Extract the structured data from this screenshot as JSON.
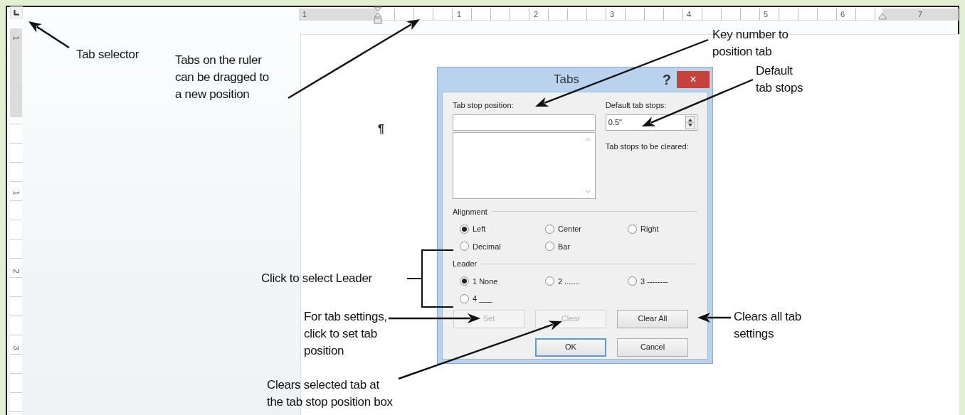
{
  "rulers": {
    "horizontal": [
      "1",
      "1",
      "2",
      "3",
      "4",
      "5",
      "6",
      "7"
    ],
    "vertical": [
      "1",
      "1",
      "2",
      "3"
    ]
  },
  "document": {
    "paragraph_mark": "¶"
  },
  "dialog": {
    "title": "Tabs",
    "help": "?",
    "close": "×",
    "tab_stop_position": {
      "label": "Tab stop position:"
    },
    "default_tab_stops": {
      "label": "Default tab stops:",
      "value": "0.5\""
    },
    "tab_stops_to_be_cleared": {
      "label": "Tab stops to be cleared:"
    },
    "alignment": {
      "label": "Alignment",
      "options": [
        {
          "label": "Left",
          "selected": true
        },
        {
          "label": "Center",
          "selected": false
        },
        {
          "label": "Right",
          "selected": false
        },
        {
          "label": "Decimal",
          "selected": false
        },
        {
          "label": "Bar",
          "selected": false
        }
      ]
    },
    "leader": {
      "label": "Leader",
      "options": [
        {
          "label": "1 None",
          "selected": true
        },
        {
          "label": "2 .......",
          "selected": false
        },
        {
          "label": "3 --------",
          "selected": false
        },
        {
          "label": "4 ___",
          "selected": false
        }
      ]
    },
    "buttons": [
      {
        "label": "Set",
        "disabled": true
      },
      {
        "label": "Clear",
        "disabled": true
      },
      {
        "label": "Clear All",
        "disabled": false
      }
    ],
    "footer_buttons": [
      {
        "label": "OK",
        "default": true
      },
      {
        "label": "Cancel",
        "default": false
      }
    ]
  },
  "callouts": [
    {
      "text": "Tab selector"
    },
    {
      "text": "Tabs on the ruler\ncan be dragged to\na new position"
    },
    {
      "text": "Key number to\nposition tab"
    },
    {
      "text": "Default\ntab stops"
    },
    {
      "text": "Click to select Leader"
    },
    {
      "text": "For tab settings,\nclick to set tab\nposition"
    },
    {
      "text": "Clears selected tab at\nthe tab stop position box"
    },
    {
      "text": "Clears all tab\nsettings"
    }
  ]
}
